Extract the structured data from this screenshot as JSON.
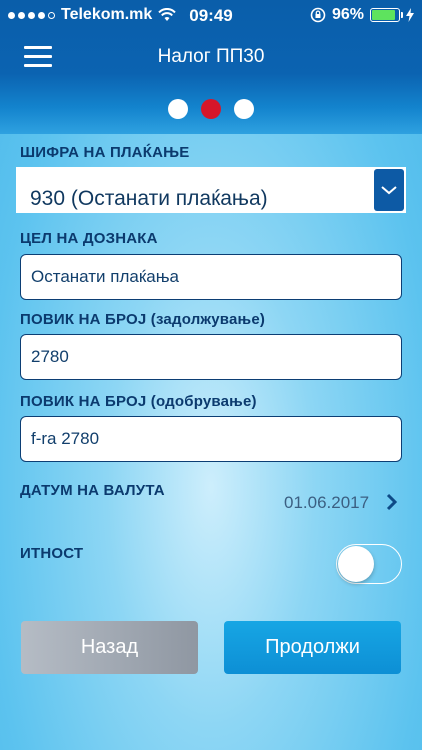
{
  "status": {
    "carrier": "Telekom.mk",
    "time": "09:49",
    "battery_percent": "96%",
    "battery_level": 0.96
  },
  "nav": {
    "title": "Налог ПП30"
  },
  "pager": {
    "pages": 3,
    "active_index": 1
  },
  "form": {
    "payment_code_label": "ШИФРА НА ПЛАЌАЊЕ",
    "payment_code_value": "930 (Останати плаќања)",
    "purpose_label": "ЦЕЛ НА ДОЗНАКА",
    "purpose_value": "Останати плаќања",
    "ref_debit_label": "ПОВИК НА БРОЈ (задолжување)",
    "ref_debit_value": "2780",
    "ref_credit_label": "ПОВИК НА БРОЈ (одобрување)",
    "ref_credit_value": "f-ra 2780",
    "value_date_label": "ДАТУМ НА ВАЛУТА",
    "value_date_value": "01.06.2017",
    "urgency_label": "ИТНОСТ",
    "urgency_on": false
  },
  "buttons": {
    "back": "Назад",
    "next": "Продолжи"
  },
  "colors": {
    "header": "#0b63b1",
    "active_dot": "#d6162a",
    "primary_button": "#0d8fd5",
    "secondary_button": "#9aa1ab"
  }
}
